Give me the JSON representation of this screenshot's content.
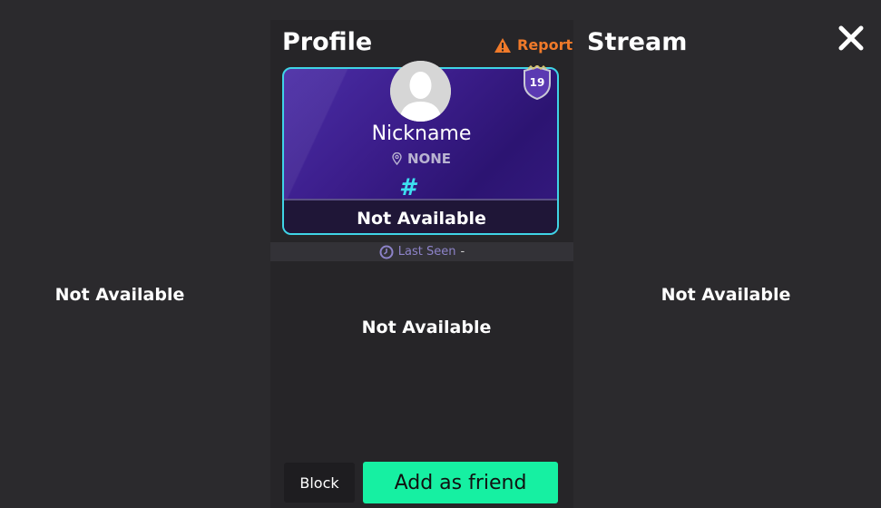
{
  "left_panel": {
    "status": "Not Available"
  },
  "profile": {
    "title": "Profile",
    "report_label": "Report",
    "level": "19",
    "nickname": "Nickname",
    "location": "NONE",
    "tag_symbol": "#",
    "card_status": "Not Available",
    "last_seen_label": "Last Seen",
    "last_seen_value": "-",
    "body_status": "Not Available",
    "block_label": "Block",
    "add_friend_label": "Add as friend"
  },
  "stream": {
    "title": "Stream",
    "status": "Not Available"
  },
  "colors": {
    "background": "#2b2a2d",
    "report": "#f07a2a",
    "accent_cyan": "#3fd4e6",
    "add_button": "#16f0a2",
    "card_purple": "#3b1d8a"
  },
  "icons": {
    "report": "warning-icon",
    "location": "location-pin-icon",
    "last_seen": "clock-icon",
    "close": "close-icon",
    "level": "shield-badge-icon",
    "avatar": "user-silhouette-icon"
  }
}
